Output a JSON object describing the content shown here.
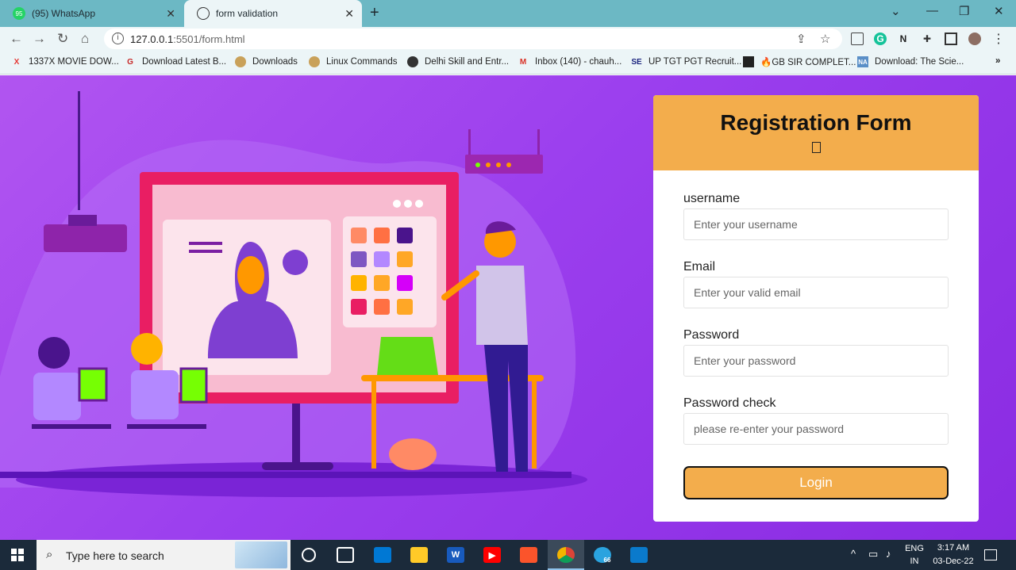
{
  "browser": {
    "tabs": [
      {
        "title": "(95) WhatsApp",
        "favicon": "whatsapp-icon",
        "badge": "95",
        "active": false
      },
      {
        "title": "form validation",
        "favicon": "globe-icon",
        "active": true
      }
    ],
    "url_host": "127.0.0.1",
    "url_path": ":5501/form.html",
    "bookmarks": [
      {
        "label": "1337X MOVIE DOW...",
        "icon": "x-logo-icon"
      },
      {
        "label": "Download Latest B...",
        "icon": "g-logo-icon"
      },
      {
        "label": "Downloads",
        "icon": "globe-icon"
      },
      {
        "label": "Linux Commands",
        "icon": "globe-icon"
      },
      {
        "label": "Delhi Skill and Entr...",
        "icon": "globe-icon"
      },
      {
        "label": "Inbox (140) - chauh...",
        "icon": "gmail-icon"
      },
      {
        "label": "UP TGT PGT Recruit...",
        "icon": "se-logo-icon"
      },
      {
        "label": "🔥GB SIR COMPLET...",
        "icon": "film-icon"
      },
      {
        "label": "Download: The Scie...",
        "icon": "na-logo-icon"
      }
    ]
  },
  "form": {
    "title": "Registration Form",
    "fields": [
      {
        "label": "username",
        "placeholder": "Enter your username"
      },
      {
        "label": "Email",
        "placeholder": "Enter your valid email"
      },
      {
        "label": "Password",
        "placeholder": "Enter your password"
      },
      {
        "label": "Password check",
        "placeholder": "please re-enter your password"
      }
    ],
    "submit_label": "Login"
  },
  "taskbar": {
    "search_placeholder": "Type here to search",
    "lang": "ENG",
    "region": "IN",
    "time": "3:17 AM",
    "date": "03-Dec-22",
    "telegram_badge": "66"
  },
  "colors": {
    "form_header": "#f3ad4c",
    "page_bg": "#9b3fee",
    "tab_strip": "#6cb8c4"
  }
}
